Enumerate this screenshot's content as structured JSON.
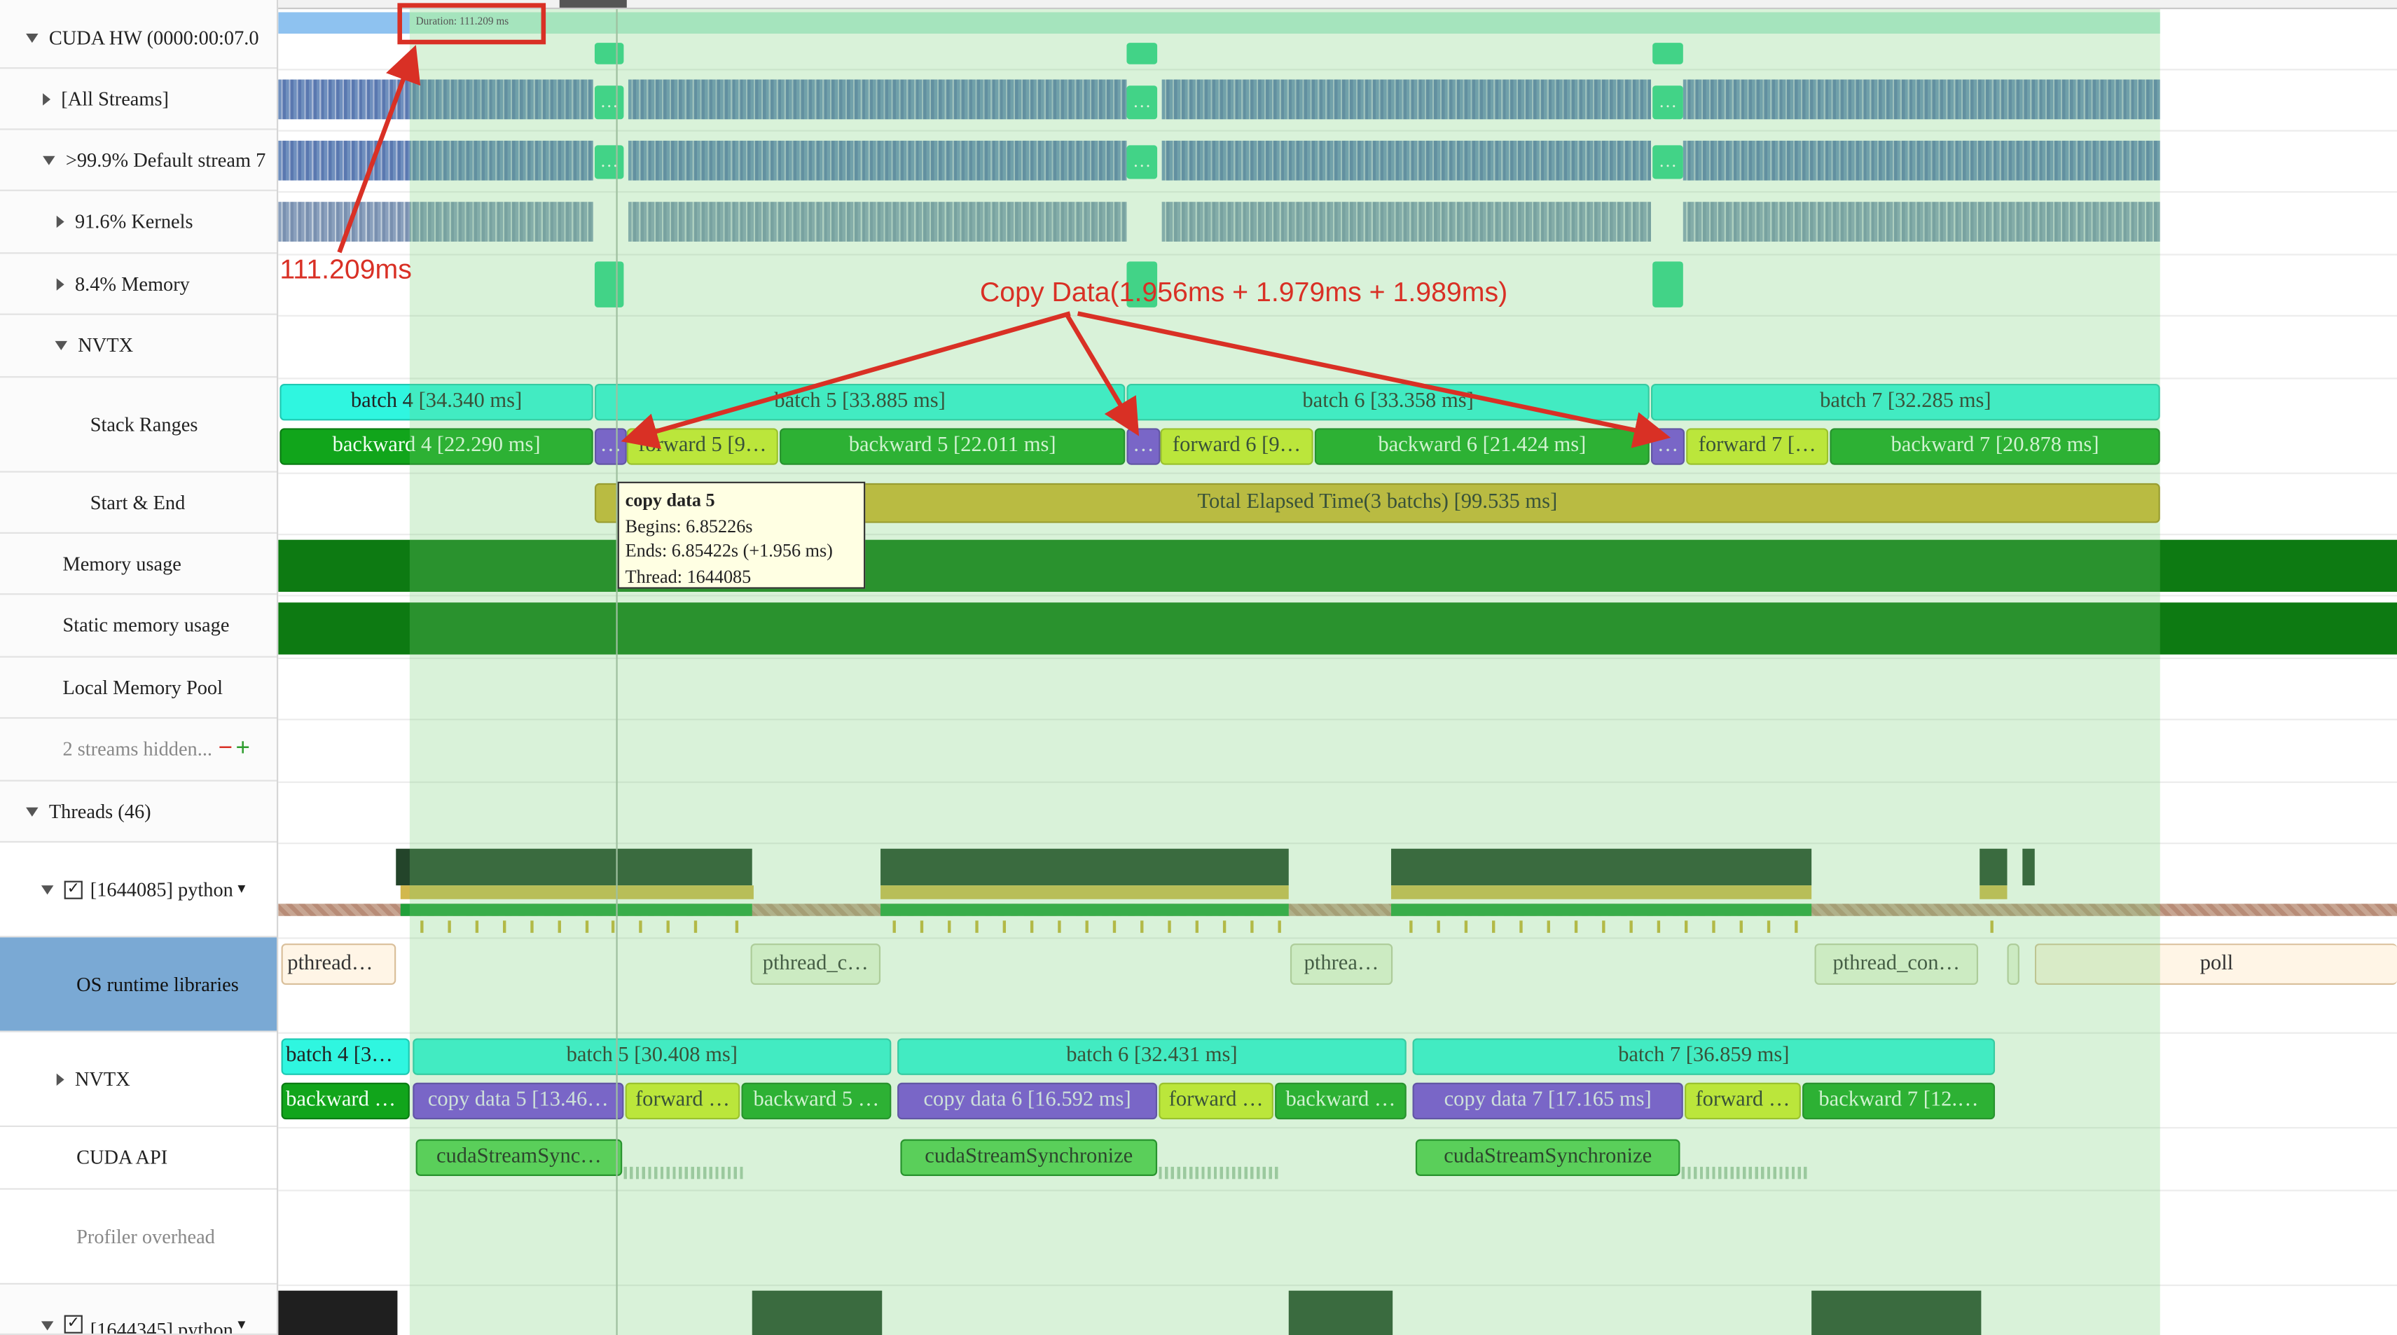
{
  "left_panel": {
    "cuda_hw": "CUDA HW (0000:00:07.0",
    "all_streams": "[All Streams]",
    "default_stream": ">99.9% Default stream 7",
    "kernels": "91.6% Kernels",
    "memory": "8.4% Memory",
    "nvtx": "NVTX",
    "stack_ranges": "Stack Ranges",
    "start_end": "Start & End",
    "memory_usage": "Memory usage",
    "static_memory_usage": "Static memory usage",
    "local_memory_pool": "Local Memory Pool",
    "streams_hidden": "2 streams hidden...",
    "minus": "−",
    "plus": "+",
    "threads": "Threads (46)",
    "thread_python": "[1644085] python",
    "os_runtime": "OS runtime libraries",
    "nvtx2": "NVTX",
    "cuda_api": "CUDA API",
    "profiler_overhead": "Profiler overhead",
    "thread_python2": "[1644345] python",
    "checkbox_mark": "✓",
    "dropdown_caret": "▾"
  },
  "timeline": {
    "duration_label": "Duration: 111.209 ms",
    "stack_ranges_row1": [
      "batch 4 [34.340 ms]",
      "batch 5 [33.885 ms]",
      "batch 6 [33.358 ms]",
      "batch 7 [32.285 ms]"
    ],
    "stack_ranges_row2": [
      "backward 4 [22.290 ms]",
      "…",
      "forward 5 [9…",
      "backward 5 [22.011 ms]",
      "…",
      "forward 6 [9…",
      "backward 6 [21.424 ms]",
      "…",
      "forward 7 […",
      "backward 7 [20.878 ms]"
    ],
    "start_end": "Total Elapsed Time(3 batchs) [99.535 ms]",
    "memory_dots": "…",
    "os_runtime": [
      "pthread…",
      "pthread_c…",
      "pthrea…",
      "pthread_con…",
      "poll"
    ],
    "nvtx_row1": [
      "batch 4 [3…",
      "batch 5 [30.408 ms]",
      "batch 6 [32.431 ms]",
      "batch 7 [36.859 ms]"
    ],
    "nvtx_row2": [
      "backward …",
      "copy data 5 [13.46…",
      "forward …",
      "backward 5 …",
      "copy data 6 [16.592 ms]",
      "forward …",
      "backward …",
      "copy data 7 [17.165 ms]",
      "forward …",
      "backward 7 [12.…"
    ],
    "cuda_api": [
      "cudaStreamSync…",
      "cudaStreamSynchronize",
      "cudaStreamSynchronize"
    ]
  },
  "tooltip": {
    "title": "copy data 5",
    "begins": "Begins: 6.85226s",
    "ends": "Ends: 6.85422s (+1.956 ms)",
    "thread": "Thread: 1644085"
  },
  "annotations": {
    "duration": "111.209ms",
    "copy_data": "Copy Data(1.956ms + 1.979ms + 1.989ms)"
  },
  "colors": {
    "annotation_red": "#d93025",
    "selection_green": "#d6f2d4",
    "batch_cyan": "#2ff6e0",
    "backward_green": "#11a51b",
    "forward_lime": "#d6ef24",
    "copy_purple": "#7a3de6",
    "start_end_gold": "#d3b32f"
  }
}
